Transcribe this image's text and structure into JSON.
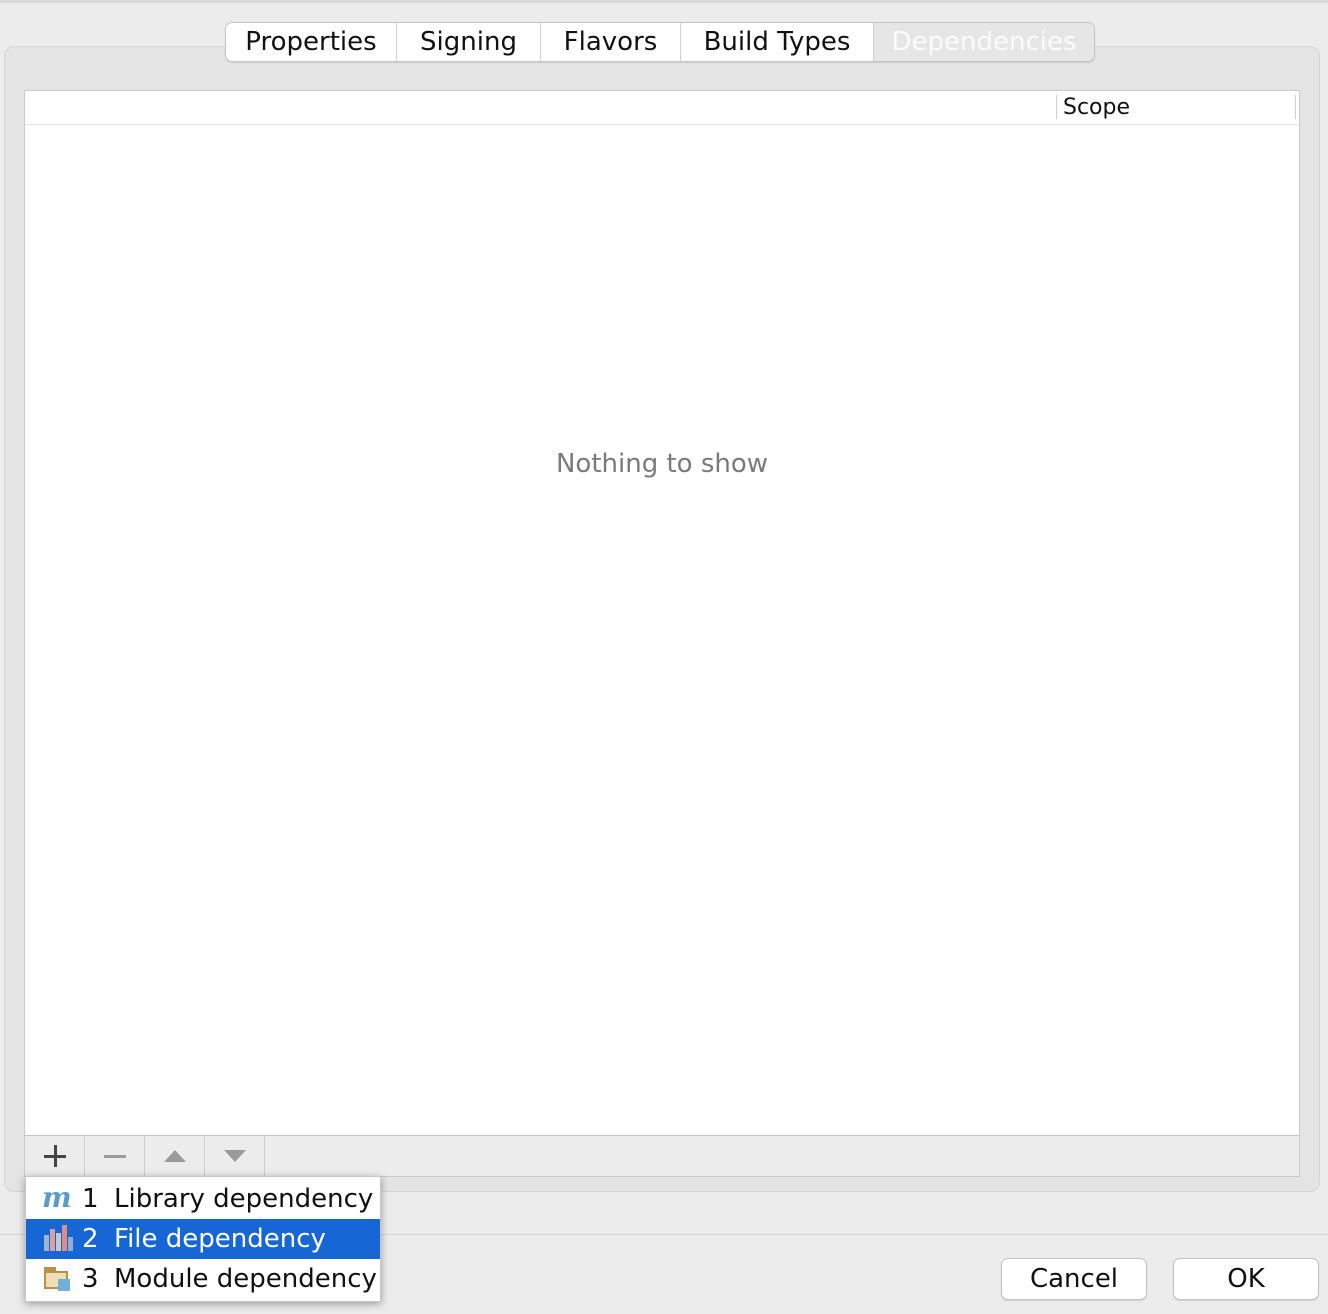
{
  "tabs": [
    {
      "label": "Properties",
      "active": false
    },
    {
      "label": "Signing",
      "active": false
    },
    {
      "label": "Flavors",
      "active": false
    },
    {
      "label": "Build Types",
      "active": false
    },
    {
      "label": "Dependencies",
      "active": true
    }
  ],
  "table": {
    "columns": [
      "Scope"
    ],
    "empty_text": "Nothing to show"
  },
  "toolbar": {
    "buttons": [
      "plus-icon",
      "minus-icon",
      "arrow-up-icon",
      "arrow-down-icon"
    ]
  },
  "popup": {
    "items": [
      {
        "number": "1",
        "label": "Library dependency",
        "icon": "maven-icon",
        "selected": false
      },
      {
        "number": "2",
        "label": "File dependency",
        "icon": "file-icon",
        "selected": true
      },
      {
        "number": "3",
        "label": "Module dependency",
        "icon": "module-folder-icon",
        "selected": false
      }
    ]
  },
  "buttons": {
    "cancel": "Cancel",
    "ok": "OK"
  },
  "colors": {
    "selection": "#1766d6",
    "window_bg": "#ececec"
  }
}
